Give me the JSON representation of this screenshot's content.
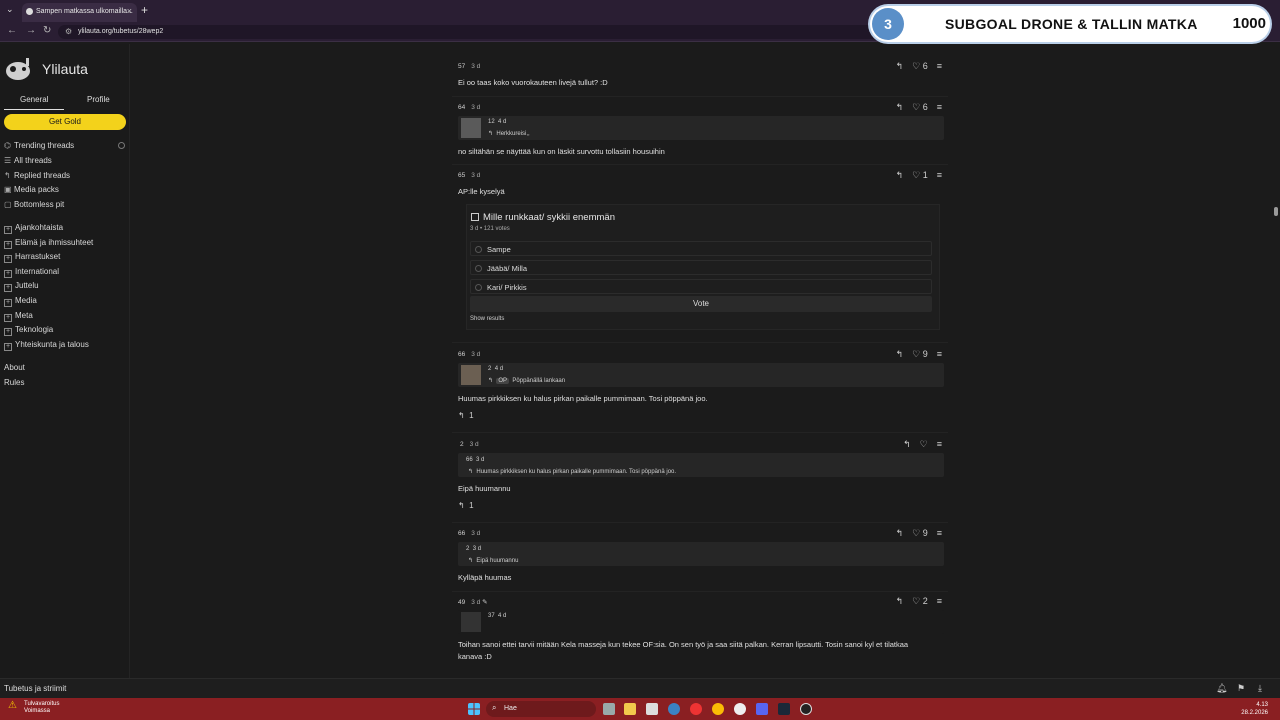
{
  "browser": {
    "tab_title": "Sampen matkassa ulkomailla...",
    "url": "ylilauta.org/tubetus/28wep2"
  },
  "overlay": {
    "number": "3",
    "title": "SUBGOAL DRONE & TALLIN MATKA",
    "goal": "1000"
  },
  "sidebar": {
    "site_name": "Ylilauta",
    "tabs": [
      "General",
      "Profile"
    ],
    "gold_label": "Get Gold",
    "nav": [
      {
        "icon": "trending-icon",
        "label": "Trending threads"
      },
      {
        "icon": "threads-icon",
        "label": "All threads"
      },
      {
        "icon": "reply-icon",
        "label": "Replied threads"
      },
      {
        "icon": "media-icon",
        "label": "Media packs"
      },
      {
        "icon": "pit-icon",
        "label": "Bottomless pit"
      }
    ],
    "boards": [
      "Ajankohtaista",
      "Elämä ja ihmissuhteet",
      "Harrastukset",
      "International",
      "Juttelu",
      "Media",
      "Meta",
      "Teknologia",
      "Yhteiskunta ja talous"
    ],
    "links": [
      "About",
      "Rules"
    ]
  },
  "posts": [
    {
      "id": "57",
      "age": "3 d",
      "likes": "6",
      "text": "Ei oo taas koko vuorokauteen livejä tullut? :D"
    },
    {
      "id": "64",
      "age": "3 d",
      "likes": "6",
      "quote_id": "12",
      "quote_age": "4 d",
      "quote_text": "Herkkureisi,,",
      "text": "no siltähän se näyttää kun on läskit survottu tollasiin housuihin"
    },
    {
      "id": "65",
      "age": "3 d",
      "likes": "1",
      "text": "AP:lle kyselyä"
    },
    {
      "id": "66",
      "age": "3 d",
      "likes": "9",
      "quote_id": "2",
      "quote_age": "4 d",
      "quote_op": "OP",
      "quote_text": "Pöppänällä lankaan",
      "text": "Huumas pirkkiksen ku halus pirkan paikalle pummimaan. Tosi pöppänä joo.",
      "replies": "1"
    },
    {
      "id": "2",
      "age": "3 d",
      "likes": "",
      "quote_id": "66",
      "quote_age": "3 d",
      "quote_text": "Huumas pirkkiksen ku halus pirkan paikalle pummimaan. Tosi pöppänä joo.",
      "text": "Eipä huumannu",
      "replies": "1"
    },
    {
      "id": "66",
      "age": "3 d",
      "likes": "9",
      "quote_id": "2",
      "quote_age": "3 d",
      "quote_text": "Eipä huumannu",
      "text": "Kylläpä huumas"
    },
    {
      "id": "49",
      "age": "3 d",
      "likes": "2",
      "quote_id": "37",
      "quote_age": "4 d",
      "text": "Toihan sanoi ettei tarvii mitään Kela masseja kun tekee OF:sia. On sen työ ja saa siitä palkan. Kerran lipsautti. Tosin sanoi kyl et tilatkaa",
      "text2": "kanava :D"
    }
  ],
  "poll": {
    "title": "Mille runkkaat/ sykkii enemmän",
    "meta": "3 d • 121 votes",
    "options": [
      "Sampe",
      "Jääbä/ Milla",
      "Kari/ Pirkkis"
    ],
    "vote_label": "Vote",
    "show_results": "Show results"
  },
  "bottombar": {
    "title": "Tubetus ja striimit"
  },
  "taskbar": {
    "weather_title": "Tulvavaroitus",
    "weather_sub": "Voimassa",
    "search_placeholder": "Hae",
    "time": "4.13",
    "date": "28.2.2026"
  },
  "colors": {
    "gold": "#f3d21b",
    "taskbar": "#8a1f22",
    "browser": "#2a1e33",
    "overlay_accent": "#5a8fc8"
  }
}
